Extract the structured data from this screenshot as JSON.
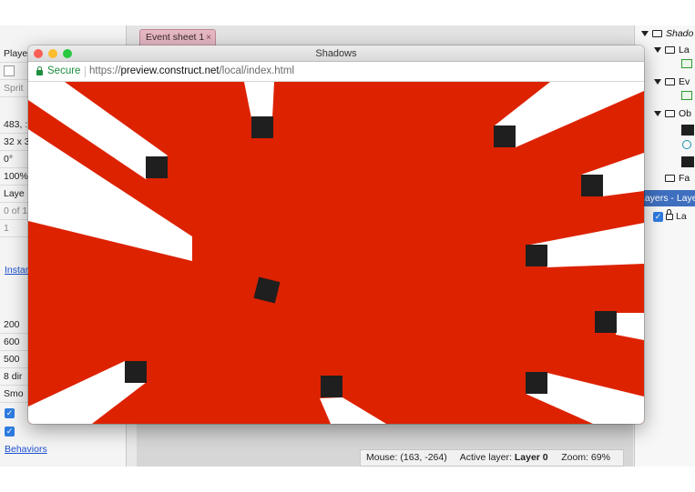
{
  "colors": {
    "game_background": "#dd2200",
    "shadow": "#ffffff",
    "block": "#1f1f1f",
    "secure_green": "#1e8e3e",
    "tab_pink": "#e6b8c4",
    "selection_blue": "#3f6fbf"
  },
  "properties_panel": {
    "rows": [
      "Playe",
      "",
      "Sprit",
      "483, :",
      "32 x 3",
      "0°",
      "100%",
      "Laye",
      "0 of 1",
      "1",
      "Instan",
      "200",
      "600",
      "500",
      "8 dir",
      "Smo"
    ],
    "instance_link": "Instan",
    "behaviors_link": "Behaviors",
    "checkbox_glyph": "✓"
  },
  "tabs": {
    "event_sheet": "Event sheet 1",
    "close_glyph": "×"
  },
  "project_panel": {
    "root": "Shado",
    "items": [
      "La",
      "Ev",
      "Ob",
      "Fa"
    ],
    "layers_header": "Layers - Laye",
    "layer_name": "La"
  },
  "status_bar": {
    "mouse_label": "Mouse:",
    "mouse_value": "(163, -264)",
    "active_layer_label": "Active layer:",
    "active_layer_value": "Layer 0",
    "zoom_label": "Zoom:",
    "zoom_value": "69%"
  },
  "browser": {
    "title": "Shadows",
    "secure_label": "Secure",
    "url_scheme": "https://",
    "url_host": "preview.construct.net",
    "url_path": "/local/index.html"
  }
}
